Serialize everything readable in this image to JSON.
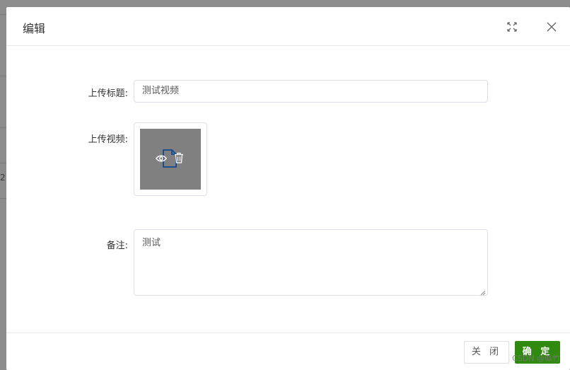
{
  "dialog": {
    "title": "编辑"
  },
  "form": {
    "title_label": "上传标题:",
    "title_value": "测试视频",
    "video_label": "上传视频:",
    "remark_label": "备注:",
    "remark_value": "测试"
  },
  "footer": {
    "close_label": "关 闭",
    "ok_label": "确 定"
  },
  "background": {
    "edge_text": "2"
  },
  "watermark": "CSDN @似竹",
  "colors": {
    "primary": "#2f8a0f",
    "overlay": "#8c8c8c",
    "thumb": "#808080"
  },
  "icons": {
    "maximize": "maximize-icon",
    "close": "close-icon",
    "file": "file-icon",
    "preview": "eye-icon",
    "delete": "trash-icon"
  }
}
